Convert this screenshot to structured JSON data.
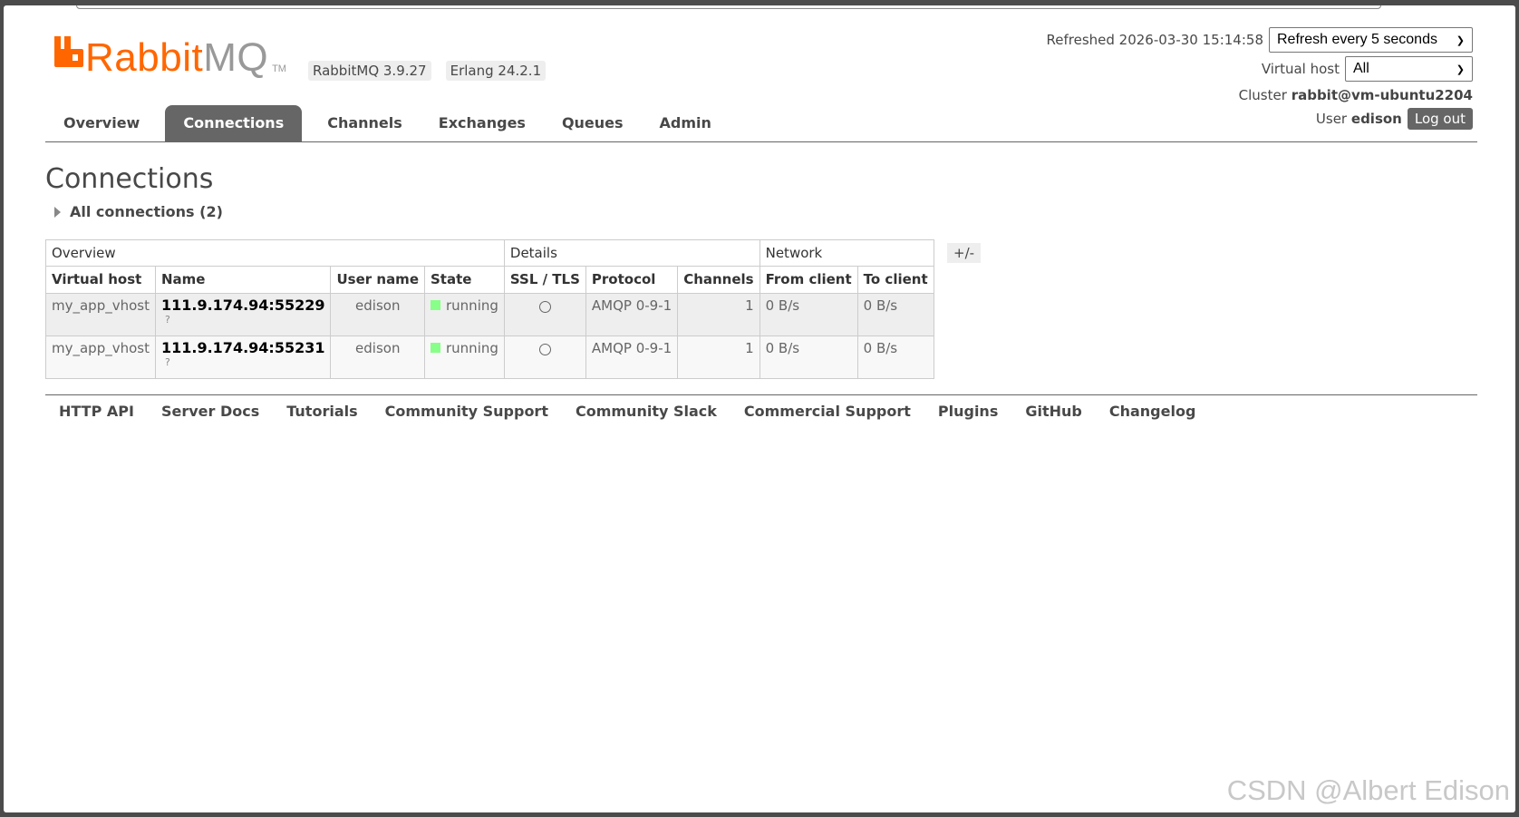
{
  "brand": {
    "name_rabbit": "Rabbit",
    "name_mq": "MQ",
    "tm": "TM",
    "version_rabbitmq": "RabbitMQ 3.9.27",
    "version_erlang": "Erlang 24.2.1",
    "brand_color": "#ff6600"
  },
  "header": {
    "refreshed_label": "Refreshed 2026-03-30 15:14:58",
    "refresh_select": "Refresh every 5 seconds",
    "vhost_label": "Virtual host",
    "vhost_select": "All",
    "cluster_label": "Cluster",
    "cluster_name": "rabbit@vm-ubuntu2204",
    "user_label": "User",
    "user_name": "edison",
    "logout": "Log out"
  },
  "nav": {
    "tabs": [
      "Overview",
      "Connections",
      "Channels",
      "Exchanges",
      "Queues",
      "Admin"
    ],
    "active": "Connections"
  },
  "main": {
    "title": "Connections",
    "section_label": "All connections (2)",
    "column_toggle": "+/-",
    "groups": [
      "Overview",
      "Details",
      "Network"
    ],
    "columns": [
      "Virtual host",
      "Name",
      "User name",
      "State",
      "SSL / TLS",
      "Protocol",
      "Channels",
      "From client",
      "To client"
    ],
    "rows": [
      {
        "vhost": "my_app_vhost",
        "name": "111.9.174.94:55229",
        "name_note": "?",
        "user": "edison",
        "state": "running",
        "protocol": "AMQP 0-9-1",
        "channels": "1",
        "from_client": "0 B/s",
        "to_client": "0 B/s"
      },
      {
        "vhost": "my_app_vhost",
        "name": "111.9.174.94:55231",
        "name_note": "?",
        "user": "edison",
        "state": "running",
        "protocol": "AMQP 0-9-1",
        "channels": "1",
        "from_client": "0 B/s",
        "to_client": "0 B/s"
      }
    ]
  },
  "footer": {
    "links": [
      "HTTP API",
      "Server Docs",
      "Tutorials",
      "Community Support",
      "Community Slack",
      "Commercial Support",
      "Plugins",
      "GitHub",
      "Changelog"
    ]
  },
  "watermark": "CSDN @Albert Edison"
}
